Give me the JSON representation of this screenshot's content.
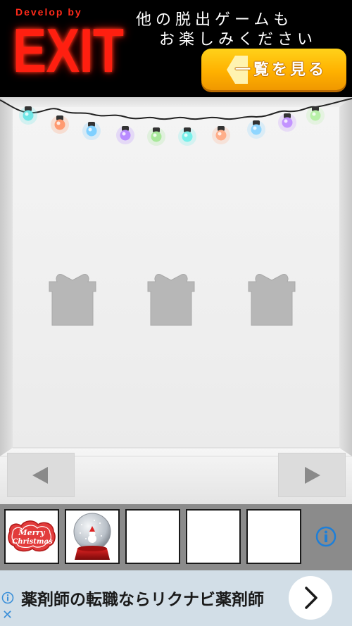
{
  "banner": {
    "developer_prefix": "Develop by",
    "brand": "EXIT",
    "promo_line1": "他の脱出ゲームも",
    "promo_line2": "お楽しみください",
    "list_button_label": "一覧を見る"
  },
  "room": {
    "light_colors": [
      "#6fe6e6",
      "#ff9a70",
      "#7fd0ff",
      "#b98cff",
      "#a8e89a",
      "#78f0ea",
      "#ffae8a",
      "#8fd6ff",
      "#c394ff",
      "#b8f0a8"
    ],
    "gift_silhouettes": 3,
    "nav_left_icon": "left-arrow-icon",
    "nav_right_icon": "right-arrow-icon"
  },
  "inventory": {
    "slots": [
      {
        "item": "merry-christmas-sign",
        "label_line1": "Merry",
        "label_line2": "Christmas"
      },
      {
        "item": "snow-globe"
      },
      {
        "item": ""
      },
      {
        "item": ""
      },
      {
        "item": ""
      }
    ],
    "info_icon": "info-icon"
  },
  "ad": {
    "text": "薬剤師の転職ならリクナビ薬剤師",
    "arrow_icon": "chevron-right-icon",
    "info_icon": "ad-info-icon",
    "close_label": "✕"
  }
}
